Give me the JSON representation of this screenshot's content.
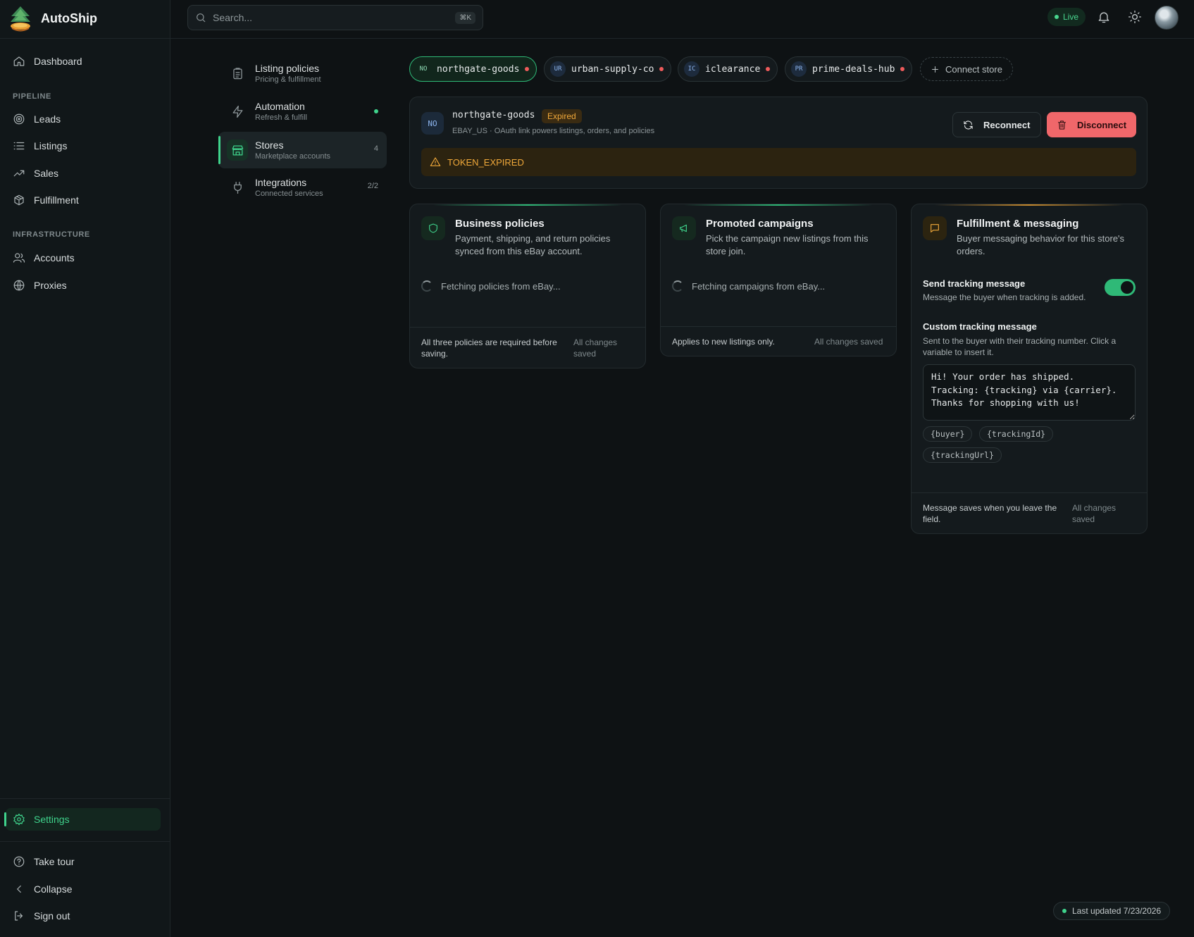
{
  "app": {
    "name": "AutoShip"
  },
  "sidebar": {
    "dashboard": "Dashboard",
    "pipeline_label": "PIPELINE",
    "pipeline": [
      "Leads",
      "Listings",
      "Sales",
      "Fulfillment"
    ],
    "infrastructure_label": "INFRASTRUCTURE",
    "infrastructure": [
      "Accounts",
      "Proxies"
    ],
    "settings": "Settings",
    "take_tour": "Take tour",
    "collapse": "Collapse",
    "sign_out": "Sign out"
  },
  "topbar": {
    "search_placeholder": "Search...",
    "shortcut": "⌘K",
    "status": "Live"
  },
  "settings_nav": [
    {
      "title": "Listing policies",
      "subtitle": "Pricing & fulfillment",
      "badge": ""
    },
    {
      "title": "Automation",
      "subtitle": "Refresh & fulfill",
      "badge": ""
    },
    {
      "title": "Stores",
      "subtitle": "Marketplace accounts",
      "badge": "4"
    },
    {
      "title": "Integrations",
      "subtitle": "Connected services",
      "badge": "2/2"
    }
  ],
  "stores": [
    {
      "code": "NO",
      "name": "northgate-goods"
    },
    {
      "code": "UR",
      "name": "urban-supply-co"
    },
    {
      "code": "IC",
      "name": "iclearance"
    },
    {
      "code": "PR",
      "name": "prime-deals-hub"
    }
  ],
  "connect_store": "Connect store",
  "selected_store": {
    "code": "NO",
    "name": "northgate-goods",
    "status": "Expired",
    "meta": "EBAY_US · OAuth link powers listings, orders, and policies",
    "reconnect": "Reconnect",
    "disconnect": "Disconnect",
    "warning": "TOKEN_EXPIRED"
  },
  "cards": {
    "business": {
      "title": "Business policies",
      "description": "Payment, shipping, and return policies synced from this eBay account.",
      "loading": "Fetching policies from eBay...",
      "footer": "All three policies are required before saving.",
      "saved": "All changes saved"
    },
    "promoted": {
      "title": "Promoted campaigns",
      "description": "Pick the campaign new listings from this store join.",
      "loading": "Fetching campaigns from eBay...",
      "footer": "Applies to new listings only.",
      "saved": "All changes saved"
    },
    "fulfillment": {
      "title": "Fulfillment & messaging",
      "description": "Buyer messaging behavior for this store's orders.",
      "toggle_label": "Send tracking message",
      "toggle_sub": "Message the buyer when tracking is added.",
      "custom_label": "Custom tracking message",
      "custom_sub": "Sent to the buyer with their tracking number. Click a variable to insert it.",
      "message": "Hi! Your order has shipped.\nTracking: {tracking} via {carrier}.\nThanks for shopping with us!",
      "variables": [
        "{buyer}",
        "{trackingId}",
        "{trackingUrl}"
      ],
      "footer": "Message saves when you leave the field.",
      "saved": "All changes saved"
    }
  },
  "last_updated": "Last updated 7/23/2026",
  "colors": {
    "accent": "#3fd38c",
    "danger": "#f0676a",
    "warning": "#f1a93a"
  }
}
